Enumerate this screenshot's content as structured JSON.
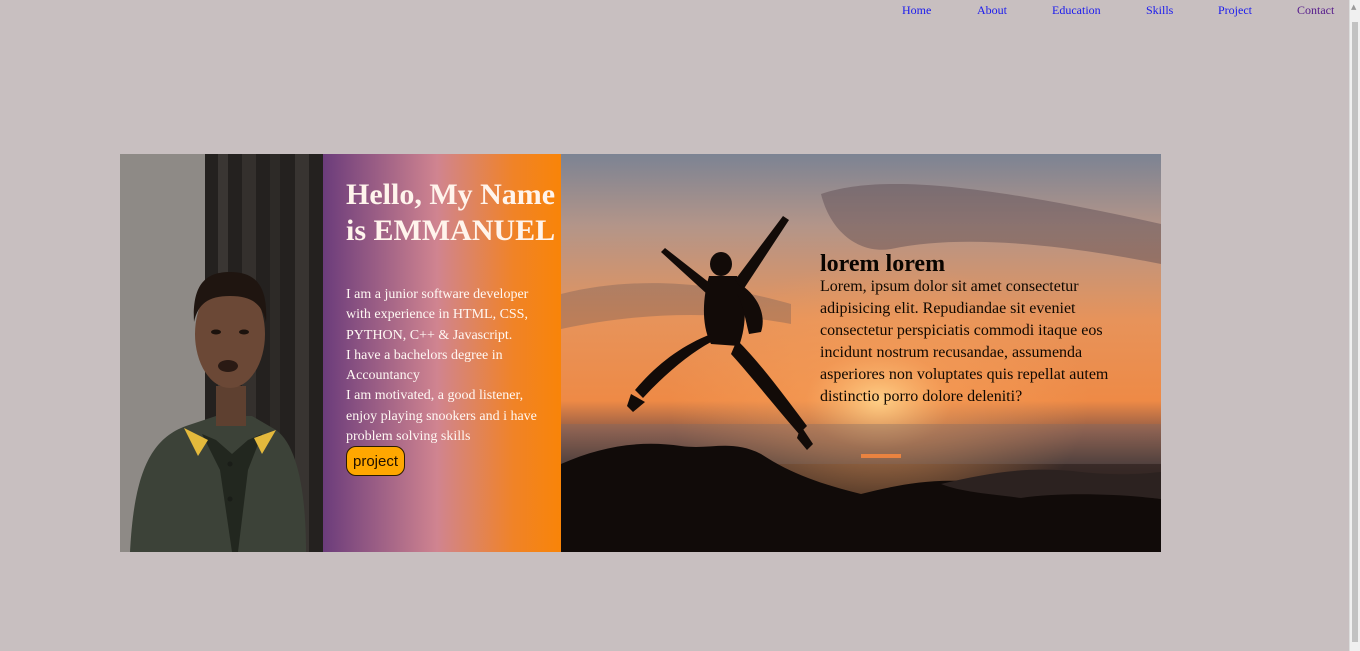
{
  "nav": {
    "items": [
      {
        "label": "Home"
      },
      {
        "label": "About"
      },
      {
        "label": "Education"
      },
      {
        "label": "Skills"
      },
      {
        "label": "Project"
      },
      {
        "label": "Contact"
      }
    ]
  },
  "intro": {
    "heading": "Hello, My Name is EMMANUEL",
    "bio": [
      "I am a junior software developer with experience in HTML, CSS, PYTHON, C++ & Javascript.",
      "I have a bachelors degree in Accountancy",
      "I am motivated, a good listener, enjoy playing snookers and i have problem solving skills"
    ],
    "button_label": "project"
  },
  "feature": {
    "heading": "lorem lorem",
    "body": "Lorem, ipsum dolor sit amet consectetur adipisicing elit. Repudiandae sit eveniet consectetur perspiciatis commodi itaque eos incidunt nostrum recusandae, assumenda asperiores non voluptates quis repellat autem distinctio porro dolore deleniti?"
  },
  "colors": {
    "page_background": "#c8bfc0",
    "link": "#1a1aee",
    "visited_link": "#551a8b",
    "button": "#ffa700",
    "gradient": [
      "#6b3c7b",
      "#d08490",
      "#f98408"
    ]
  }
}
